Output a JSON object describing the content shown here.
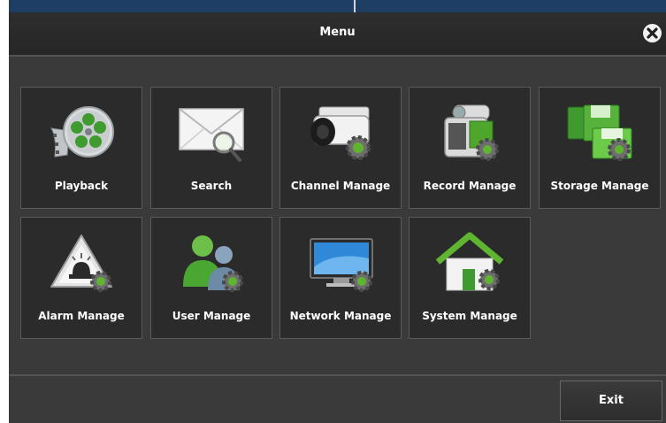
{
  "window": {
    "title": "Menu"
  },
  "menu_items": [
    {
      "label": "Playback",
      "icon": "film-reel-icon"
    },
    {
      "label": "Search",
      "icon": "envelope-magnifier-icon"
    },
    {
      "label": "Channel Manage",
      "icon": "camera-gear-icon"
    },
    {
      "label": "Record Manage",
      "icon": "camcorder-gear-icon"
    },
    {
      "label": "Storage Manage",
      "icon": "floppy-gear-icon"
    },
    {
      "label": "Alarm Manage",
      "icon": "alarm-gear-icon"
    },
    {
      "label": "User Manage",
      "icon": "users-gear-icon"
    },
    {
      "label": "Network Manage",
      "icon": "monitor-gear-icon"
    },
    {
      "label": "System Manage",
      "icon": "house-gear-icon"
    }
  ],
  "footer": {
    "exit_label": "Exit"
  },
  "colors": {
    "accent_green": "#5fb52f",
    "panel": "#3a3a3a"
  }
}
